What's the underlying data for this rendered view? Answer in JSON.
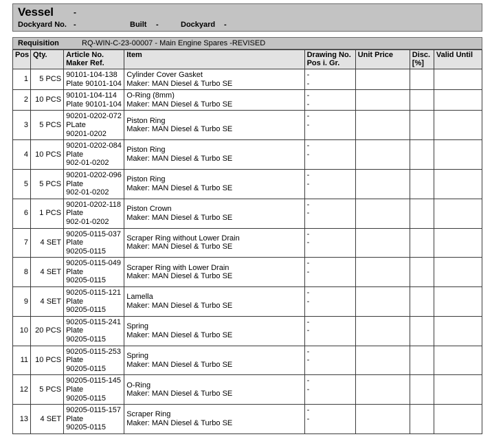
{
  "vessel_header": {
    "vessel_label": "Vessel",
    "vessel_value": "-",
    "dockyard_no_label": "Dockyard No.",
    "dockyard_no_value": "-",
    "built_label": "Built",
    "built_value": "-",
    "dockyard_label": "Dockyard",
    "dockyard_value": "-"
  },
  "requisition": {
    "label": "Requisition",
    "value": "RQ-WIN-C-23-00007 - Main Engine Spares -REVISED"
  },
  "table": {
    "columns": [
      "Pos",
      "Qty.",
      "Article No.\nMaker Ref.",
      "Item",
      "Drawing No.\nPos i. Gr.",
      "Unit Price",
      "Disc.\n[%]",
      "Valid Until"
    ],
    "rows": [
      {
        "pos": "1",
        "qty": "5 PCS",
        "article": "90101-104-138\nPlate 90101-104",
        "item": "Cylinder Cover Gasket\nMaker: MAN Diesel & Turbo SE",
        "drawing": "-\n-",
        "unit_price": "",
        "disc": "",
        "valid_until": "",
        "lines": 2
      },
      {
        "pos": "2",
        "qty": "10 PCS",
        "article": "90101-104-114\nPlate 90101-104",
        "item": "O-Ring (8mm)\nMaker: MAN Diesel & Turbo SE",
        "drawing": "-\n-",
        "unit_price": "",
        "disc": "",
        "valid_until": "",
        "lines": 2
      },
      {
        "pos": "3",
        "qty": "5 PCS",
        "article": "90201-0202-072\nPLate\n90201-0202",
        "item": "Piston Ring\nMaker: MAN Diesel & Turbo SE",
        "drawing": "-\n-",
        "unit_price": "",
        "disc": "",
        "valid_until": "",
        "lines": 3
      },
      {
        "pos": "4",
        "qty": "10 PCS",
        "article": "90201-0202-084\nPlate\n902-01-0202",
        "item": "Piston Ring\nMaker: MAN Diesel & Turbo SE",
        "drawing": "-\n-",
        "unit_price": "",
        "disc": "",
        "valid_until": "",
        "lines": 3
      },
      {
        "pos": "5",
        "qty": "5 PCS",
        "article": "90201-0202-096\nPlate\n902-01-0202",
        "item": "Piston Ring\nMaker: MAN Diesel & Turbo SE",
        "drawing": "-\n-",
        "unit_price": "",
        "disc": "",
        "valid_until": "",
        "lines": 3
      },
      {
        "pos": "6",
        "qty": "1 PCS",
        "article": "90201-0202-118\nPlate\n902-01-0202",
        "item": "Piston Crown\nMaker: MAN Diesel & Turbo SE",
        "drawing": "-\n-",
        "unit_price": "",
        "disc": "",
        "valid_until": "",
        "lines": 3
      },
      {
        "pos": "7",
        "qty": "4 SET",
        "article": "90205-0115-037\nPlate\n90205-0115",
        "item": "Scraper Ring without Lower Drain\nMaker: MAN Diesel & Turbo SE",
        "drawing": "-\n-",
        "unit_price": "",
        "disc": "",
        "valid_until": "",
        "lines": 3
      },
      {
        "pos": "8",
        "qty": "4 SET",
        "article": "90205-0115-049\nPlate\n90205-0115",
        "item": "Scraper Ring with Lower Drain\nMaker: MAN Diesel & Turbo SE",
        "drawing": "-\n-",
        "unit_price": "",
        "disc": "",
        "valid_until": "",
        "lines": 3
      },
      {
        "pos": "9",
        "qty": "4 SET",
        "article": "90205-0115-121\nPlate\n90205-0115",
        "item": "Lamella\nMaker: MAN Diesel & Turbo SE",
        "drawing": "-\n-",
        "unit_price": "",
        "disc": "",
        "valid_until": "",
        "lines": 3
      },
      {
        "pos": "10",
        "qty": "20 PCS",
        "article": "90205-0115-241\nPlate\n90205-0115",
        "item": "Spring\nMaker: MAN Diesel & Turbo SE",
        "drawing": "-\n-",
        "unit_price": "",
        "disc": "",
        "valid_until": "",
        "lines": 3
      },
      {
        "pos": "11",
        "qty": "10 PCS",
        "article": "90205-0115-253\nPlate\n90205-0115",
        "item": "Spring\nMaker: MAN Diesel & Turbo SE",
        "drawing": "-\n-",
        "unit_price": "",
        "disc": "",
        "valid_until": "",
        "lines": 3
      },
      {
        "pos": "12",
        "qty": "5 PCS",
        "article": "90205-0115-145\nPlate\n90205-0115",
        "item": "O-Ring\nMaker: MAN Diesel & Turbo SE",
        "drawing": "-\n-",
        "unit_price": "",
        "disc": "",
        "valid_until": "",
        "lines": 3
      },
      {
        "pos": "13",
        "qty": "4 SET",
        "article": "90205-0115-157\nPlate\n90205-0115",
        "item": "Scraper Ring\nMaker: MAN Diesel & Turbo SE",
        "drawing": "-\n-",
        "unit_price": "",
        "disc": "",
        "valid_until": "",
        "lines": 3
      }
    ]
  }
}
